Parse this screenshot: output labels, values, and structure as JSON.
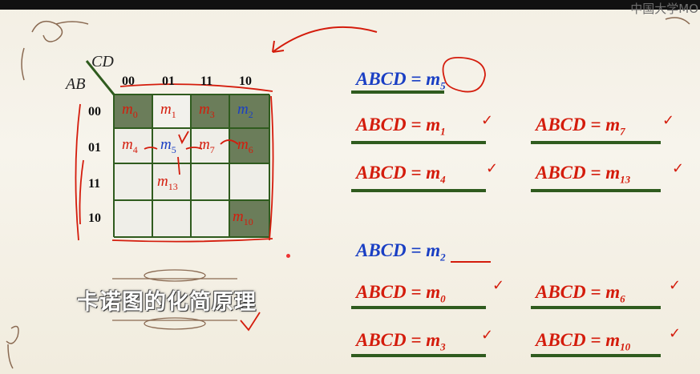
{
  "watermark": "中国大学MO",
  "slide_title": "卡诺图的化简原理",
  "kmap": {
    "row_var": "AB",
    "col_var": "CD",
    "col_labels": [
      "00",
      "01",
      "11",
      "10"
    ],
    "row_labels": [
      "00",
      "01",
      "11",
      "10"
    ],
    "cells": [
      {
        "label": "m",
        "sub": "0",
        "color": "#d41c0c"
      },
      {
        "label": "m",
        "sub": "1",
        "color": "#d41c0c"
      },
      {
        "label": "m",
        "sub": "3",
        "color": "#d41c0c"
      },
      {
        "label": "m",
        "sub": "2",
        "color": "#1a3fc4"
      },
      {
        "label": "m",
        "sub": "4",
        "color": "#d41c0c"
      },
      {
        "label": "m",
        "sub": "5",
        "color": "#1a3fc4"
      },
      {
        "label": "m",
        "sub": "7",
        "color": "#d41c0c"
      },
      {
        "label": "m",
        "sub": "6",
        "color": "#d41c0c"
      },
      {
        "label": "m",
        "sub": "13",
        "color": "#d41c0c"
      },
      {
        "label": "m",
        "sub": "10",
        "color": "#d41c0c"
      }
    ]
  },
  "equations": {
    "e1": {
      "lhs": "ABCD",
      "eq": "=",
      "rhs": "m",
      "sub": "5"
    },
    "e2": {
      "lhs": "ABCD",
      "eq": "=",
      "rhs": "m",
      "sub": "1"
    },
    "e3": {
      "lhs": "ABCD",
      "eq": "=",
      "rhs": "m",
      "sub": "7"
    },
    "e4": {
      "lhs": "ABCD",
      "eq": "=",
      "rhs": "m",
      "sub": "4"
    },
    "e5": {
      "lhs": "ABCD",
      "eq": "=",
      "rhs": "m",
      "sub": "13"
    },
    "e6": {
      "lhs": "ABCD",
      "eq": "=",
      "rhs": "m",
      "sub": "2"
    },
    "e7": {
      "lhs": "ABCD",
      "eq": "=",
      "rhs": "m",
      "sub": "0"
    },
    "e8": {
      "lhs": "ABCD",
      "eq": "=",
      "rhs": "m",
      "sub": "6"
    },
    "e9": {
      "lhs": "ABCD",
      "eq": "=",
      "rhs": "m",
      "sub": "3"
    },
    "e10": {
      "lhs": "ABCD",
      "eq": "=",
      "rhs": "m",
      "sub": "10"
    }
  },
  "check_mark": "✓",
  "colors": {
    "red": "#d41c0c",
    "blue": "#1a3fc4",
    "cell_dark": "#6b7d5a",
    "cell_light": "#efeee8",
    "underline": "#2f5b1e"
  }
}
